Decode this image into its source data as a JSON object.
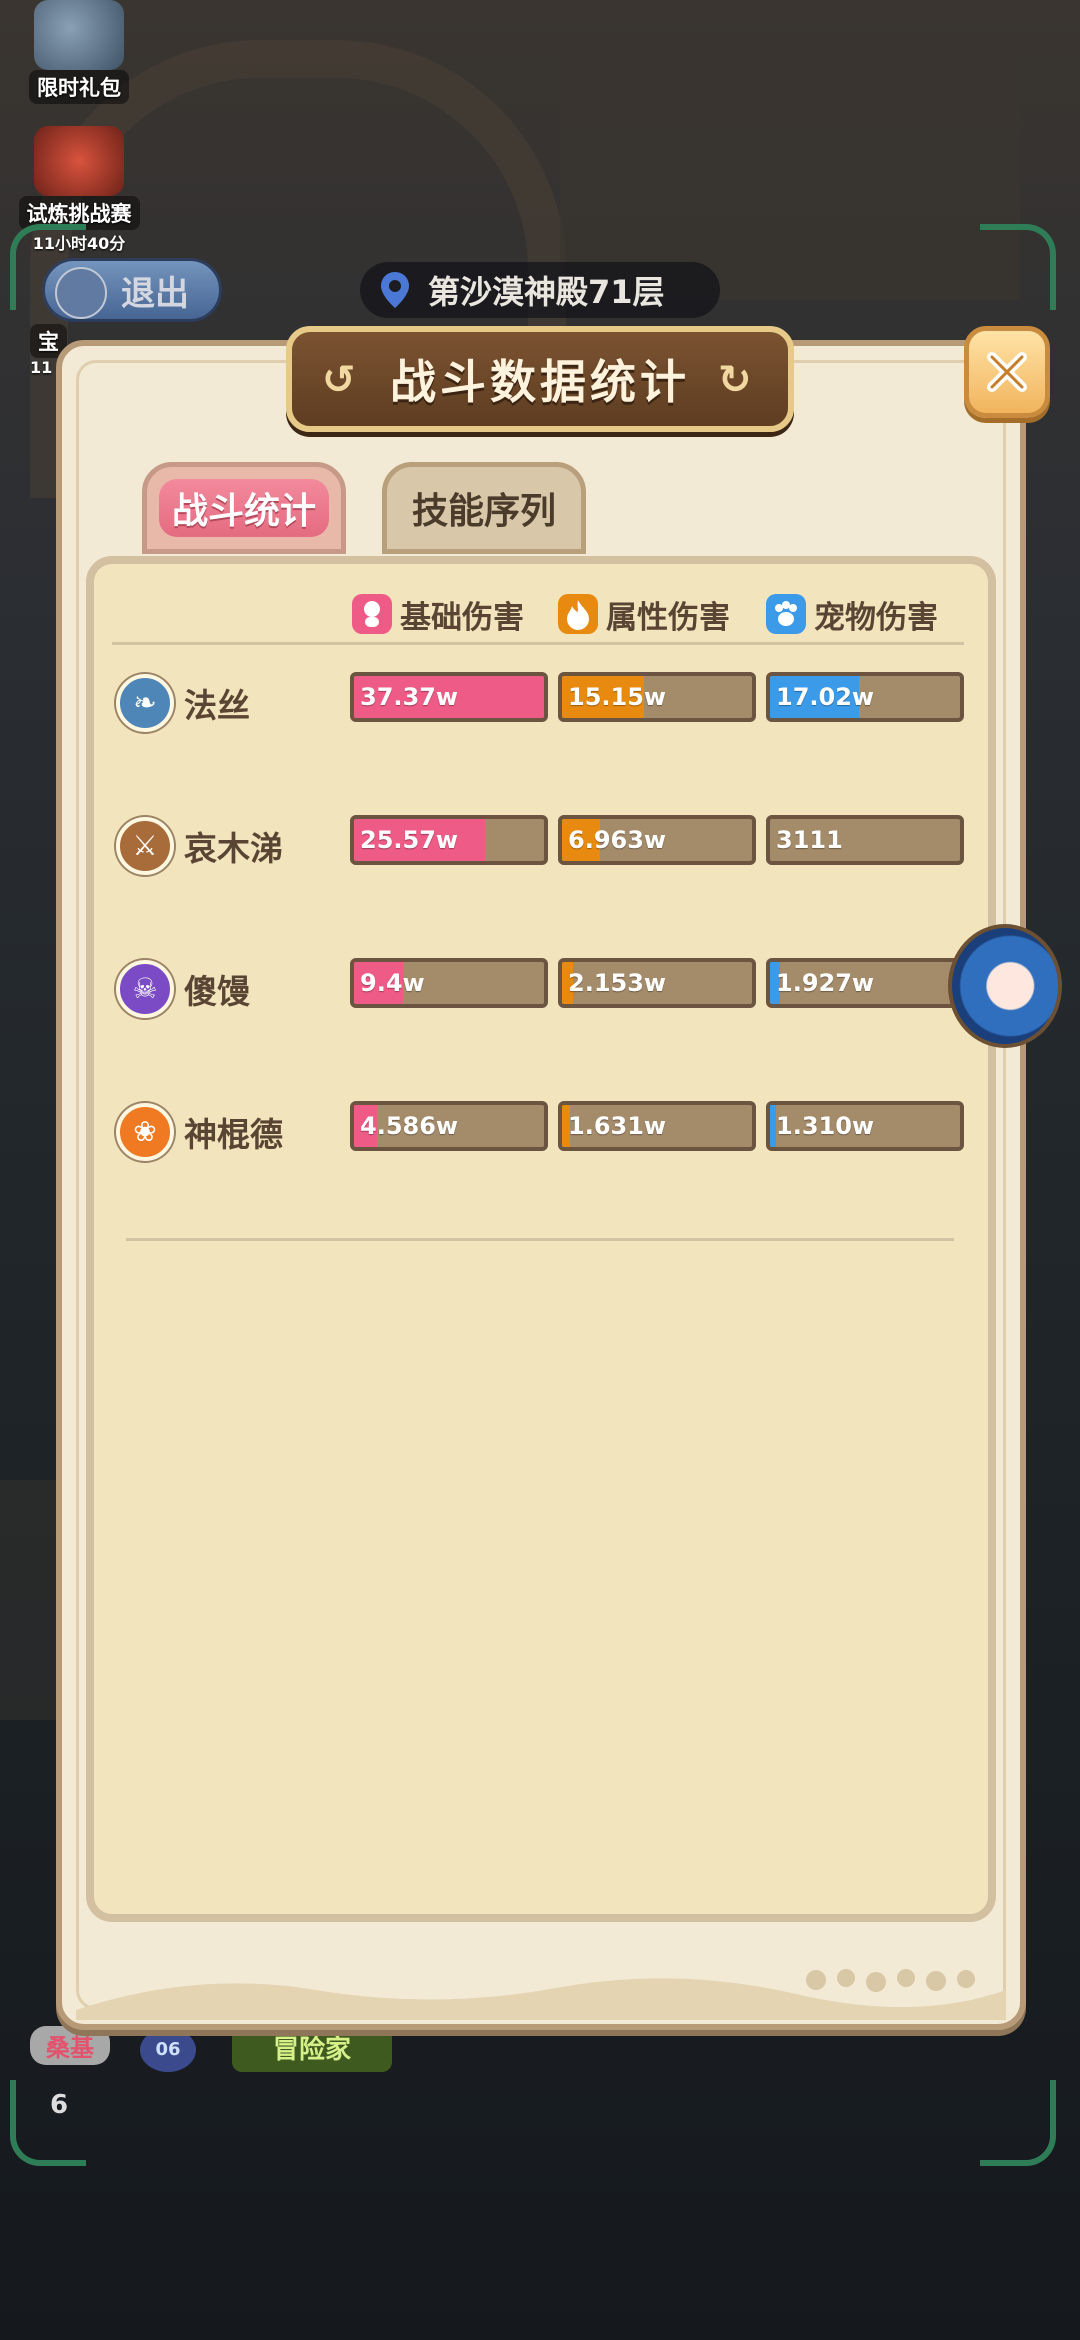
{
  "hud": {
    "widget1_label": "限时礼包",
    "widget2_label": "试炼挑战赛",
    "widget2_timer": "11小时40分",
    "widget3_label_partial": "宝",
    "widget3_sub_partial": "11",
    "exit_label": "退出",
    "location": "第沙漠神殿71层",
    "bottom_tag": "桑基",
    "bottom_level": "06",
    "bottom_title": "冒险家",
    "bottom_number": "6"
  },
  "panel": {
    "title": "战斗数据统计",
    "close_icon": "close-x-icon"
  },
  "tabs": [
    {
      "label": "战斗统计",
      "active": true
    },
    {
      "label": "技能序列",
      "active": false
    }
  ],
  "columns": [
    {
      "label": "基础伤害",
      "icon": "person-icon",
      "color": "#ee5b86"
    },
    {
      "label": "属性伤害",
      "icon": "fire-icon",
      "color": "#e88a10"
    },
    {
      "label": "宠物伤害",
      "icon": "paw-icon",
      "color": "#3c9be8"
    }
  ],
  "players": [
    {
      "name": "法丝",
      "icon": "feather-class-icon",
      "icon_color": "#4f86b8",
      "stats": [
        {
          "text": "37.37w",
          "fill": 1.0
        },
        {
          "text": "15.15w",
          "fill": 0.43
        },
        {
          "text": "17.02w",
          "fill": 0.47
        }
      ]
    },
    {
      "name": "哀木涕",
      "icon": "crossed-swords-class-icon",
      "icon_color": "#a86c3a",
      "stats": [
        {
          "text": "25.57w",
          "fill": 0.69
        },
        {
          "text": "6.963w",
          "fill": 0.2
        },
        {
          "text": "3111",
          "fill": 0.0
        }
      ]
    },
    {
      "name": "傻馒",
      "icon": "skull-class-icon",
      "icon_color": "#7a4bc4",
      "stats": [
        {
          "text": "9.4w",
          "fill": 0.26
        },
        {
          "text": "2.153w",
          "fill": 0.06
        },
        {
          "text": "1.927w",
          "fill": 0.05
        }
      ]
    },
    {
      "name": "神棍德",
      "icon": "paw-class-icon",
      "icon_color": "#f07a22",
      "stats": [
        {
          "text": "4.586w",
          "fill": 0.12
        },
        {
          "text": "1.631w",
          "fill": 0.04
        },
        {
          "text": "1.310w",
          "fill": 0.03
        }
      ]
    }
  ]
}
